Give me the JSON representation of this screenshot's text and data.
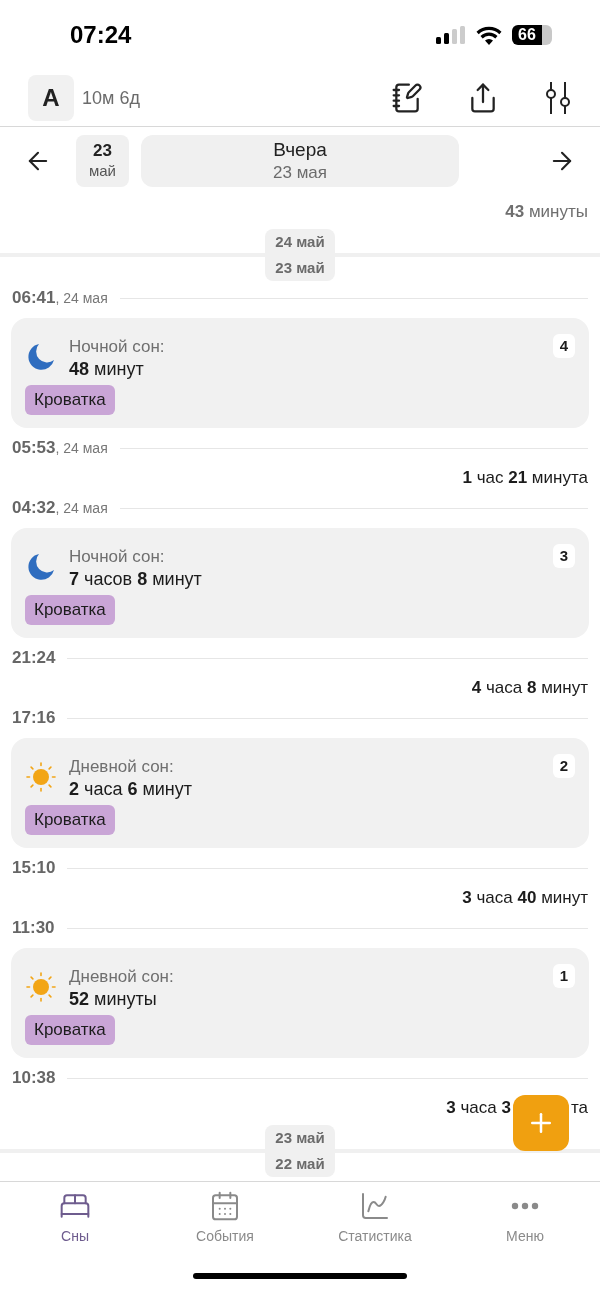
{
  "status_bar": {
    "time": "07:24",
    "battery": "66"
  },
  "header": {
    "avatar": "A",
    "age": "10м 6д"
  },
  "date_nav": {
    "chip_day": "23",
    "chip_month": "май",
    "title": "Вчера",
    "subtitle": "23 мая"
  },
  "timeline": [
    {
      "kind": "gap",
      "text": "**43** минуты",
      "muted": true
    },
    {
      "kind": "divider",
      "top": "24 май",
      "bottom": "23 май"
    },
    {
      "kind": "time",
      "time": "06:41",
      "date": ", 24 мая"
    },
    {
      "kind": "night",
      "label": "Ночной сон:",
      "duration": "**48** минут",
      "tag": "Кроватка",
      "number": "4"
    },
    {
      "kind": "time",
      "time": "05:53",
      "date": ", 24 мая"
    },
    {
      "kind": "gap",
      "text": "**1** час **21** минута",
      "muted": false
    },
    {
      "kind": "time",
      "time": "04:32",
      "date": ", 24 мая"
    },
    {
      "kind": "night",
      "label": "Ночной сон:",
      "duration": "**7** часов **8** минут",
      "tag": "Кроватка",
      "number": "3"
    },
    {
      "kind": "time",
      "time": "21:24"
    },
    {
      "kind": "gap",
      "text": "**4** часа **8** минут",
      "muted": false
    },
    {
      "kind": "time",
      "time": "17:16"
    },
    {
      "kind": "day",
      "label": "Дневной сон:",
      "duration": "**2** часа **6** минут",
      "tag": "Кроватка",
      "number": "2"
    },
    {
      "kind": "time",
      "time": "15:10"
    },
    {
      "kind": "gap",
      "text": "**3** часа **40** минут",
      "muted": false
    },
    {
      "kind": "time",
      "time": "11:30"
    },
    {
      "kind": "day",
      "label": "Дневной сон:",
      "duration": "**52** минуты",
      "tag": "Кроватка",
      "number": "1"
    },
    {
      "kind": "time",
      "time": "10:38"
    },
    {
      "kind": "gap",
      "text": "**3** часа **3**",
      "tail": "та",
      "muted": false
    },
    {
      "kind": "divider",
      "top": "23 май",
      "bottom": "22 май"
    }
  ],
  "tabs": [
    {
      "label": "Сны",
      "selected": true
    },
    {
      "label": "События",
      "selected": false
    },
    {
      "label": "Статистика",
      "selected": false
    },
    {
      "label": "Меню",
      "selected": false
    }
  ]
}
